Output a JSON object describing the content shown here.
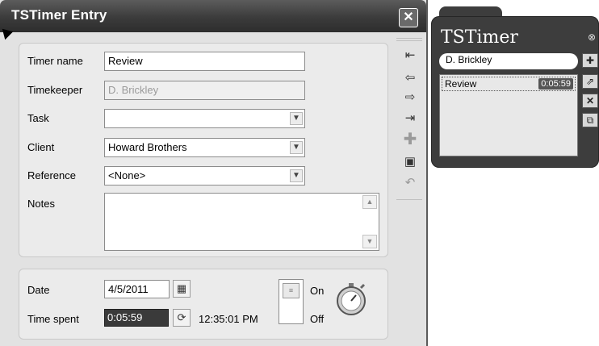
{
  "entry_window": {
    "title": "TSTimer Entry",
    "close_glyph": "✕",
    "fields": {
      "timer_name": {
        "label": "Timer name",
        "value": "Review"
      },
      "timekeeper": {
        "label": "Timekeeper",
        "value": "D. Brickley"
      },
      "task": {
        "label": "Task",
        "value": ""
      },
      "client": {
        "label": "Client",
        "value": "Howard Brothers"
      },
      "reference": {
        "label": "Reference",
        "value": "<None>"
      },
      "notes": {
        "label": "Notes",
        "value": ""
      }
    },
    "timing": {
      "date_label": "Date",
      "date_value": "4/5/2011",
      "time_spent_label": "Time spent",
      "time_spent_value": "0:05:59",
      "clock_time": "12:35:01 PM",
      "on_label": "On",
      "off_label": "Off"
    },
    "toolbar_icons": [
      "first-record-icon",
      "previous-record-icon",
      "next-record-icon",
      "last-record-icon",
      "add-icon",
      "save-icon",
      "undo-icon"
    ]
  },
  "mini_window": {
    "title": "TSTimer",
    "close_glyph": "⊗",
    "user": "D. Brickley",
    "timers": [
      {
        "name": "Review",
        "time": "0:05:59"
      }
    ],
    "side_icons": [
      "add-timer-icon",
      "open-timer-icon",
      "delete-timer-icon",
      "copy-timer-icon"
    ]
  },
  "colors": {
    "titlebar": "#3b3b3b",
    "panel": "#e2e2e2",
    "group": "#ebebeb",
    "mini_body": "#3d3d3d"
  }
}
